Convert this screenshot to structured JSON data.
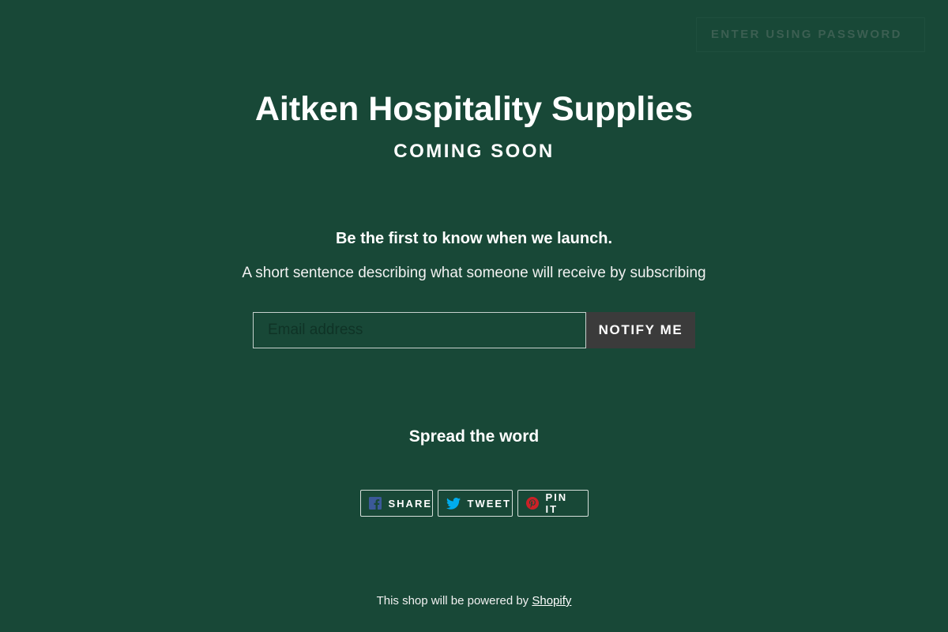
{
  "header": {
    "password_button_label": "ENTER USING PASSWORD"
  },
  "hero": {
    "shop_name": "Aitken Hospitality Supplies",
    "status": "COMING SOON"
  },
  "newsletter": {
    "heading": "Be the first to know when we launch.",
    "description": "A short sentence describing what someone will receive by subscribing",
    "email_placeholder": "Email address",
    "submit_label": "NOTIFY ME"
  },
  "social": {
    "heading": "Spread the word",
    "buttons": [
      {
        "label": "SHARE",
        "icon": "facebook-icon",
        "icon_color": "#3b5998"
      },
      {
        "label": "TWEET",
        "icon": "twitter-icon",
        "icon_color": "#00aced"
      },
      {
        "label": "PIN IT",
        "icon": "pinterest-icon",
        "icon_color": "#cb2127"
      }
    ]
  },
  "footer": {
    "text": "This shop will be powered by",
    "link_label": "Shopify"
  },
  "colors": {
    "background": "#184837",
    "button_dark": "#3b3b3b",
    "text": "#ffffff"
  }
}
